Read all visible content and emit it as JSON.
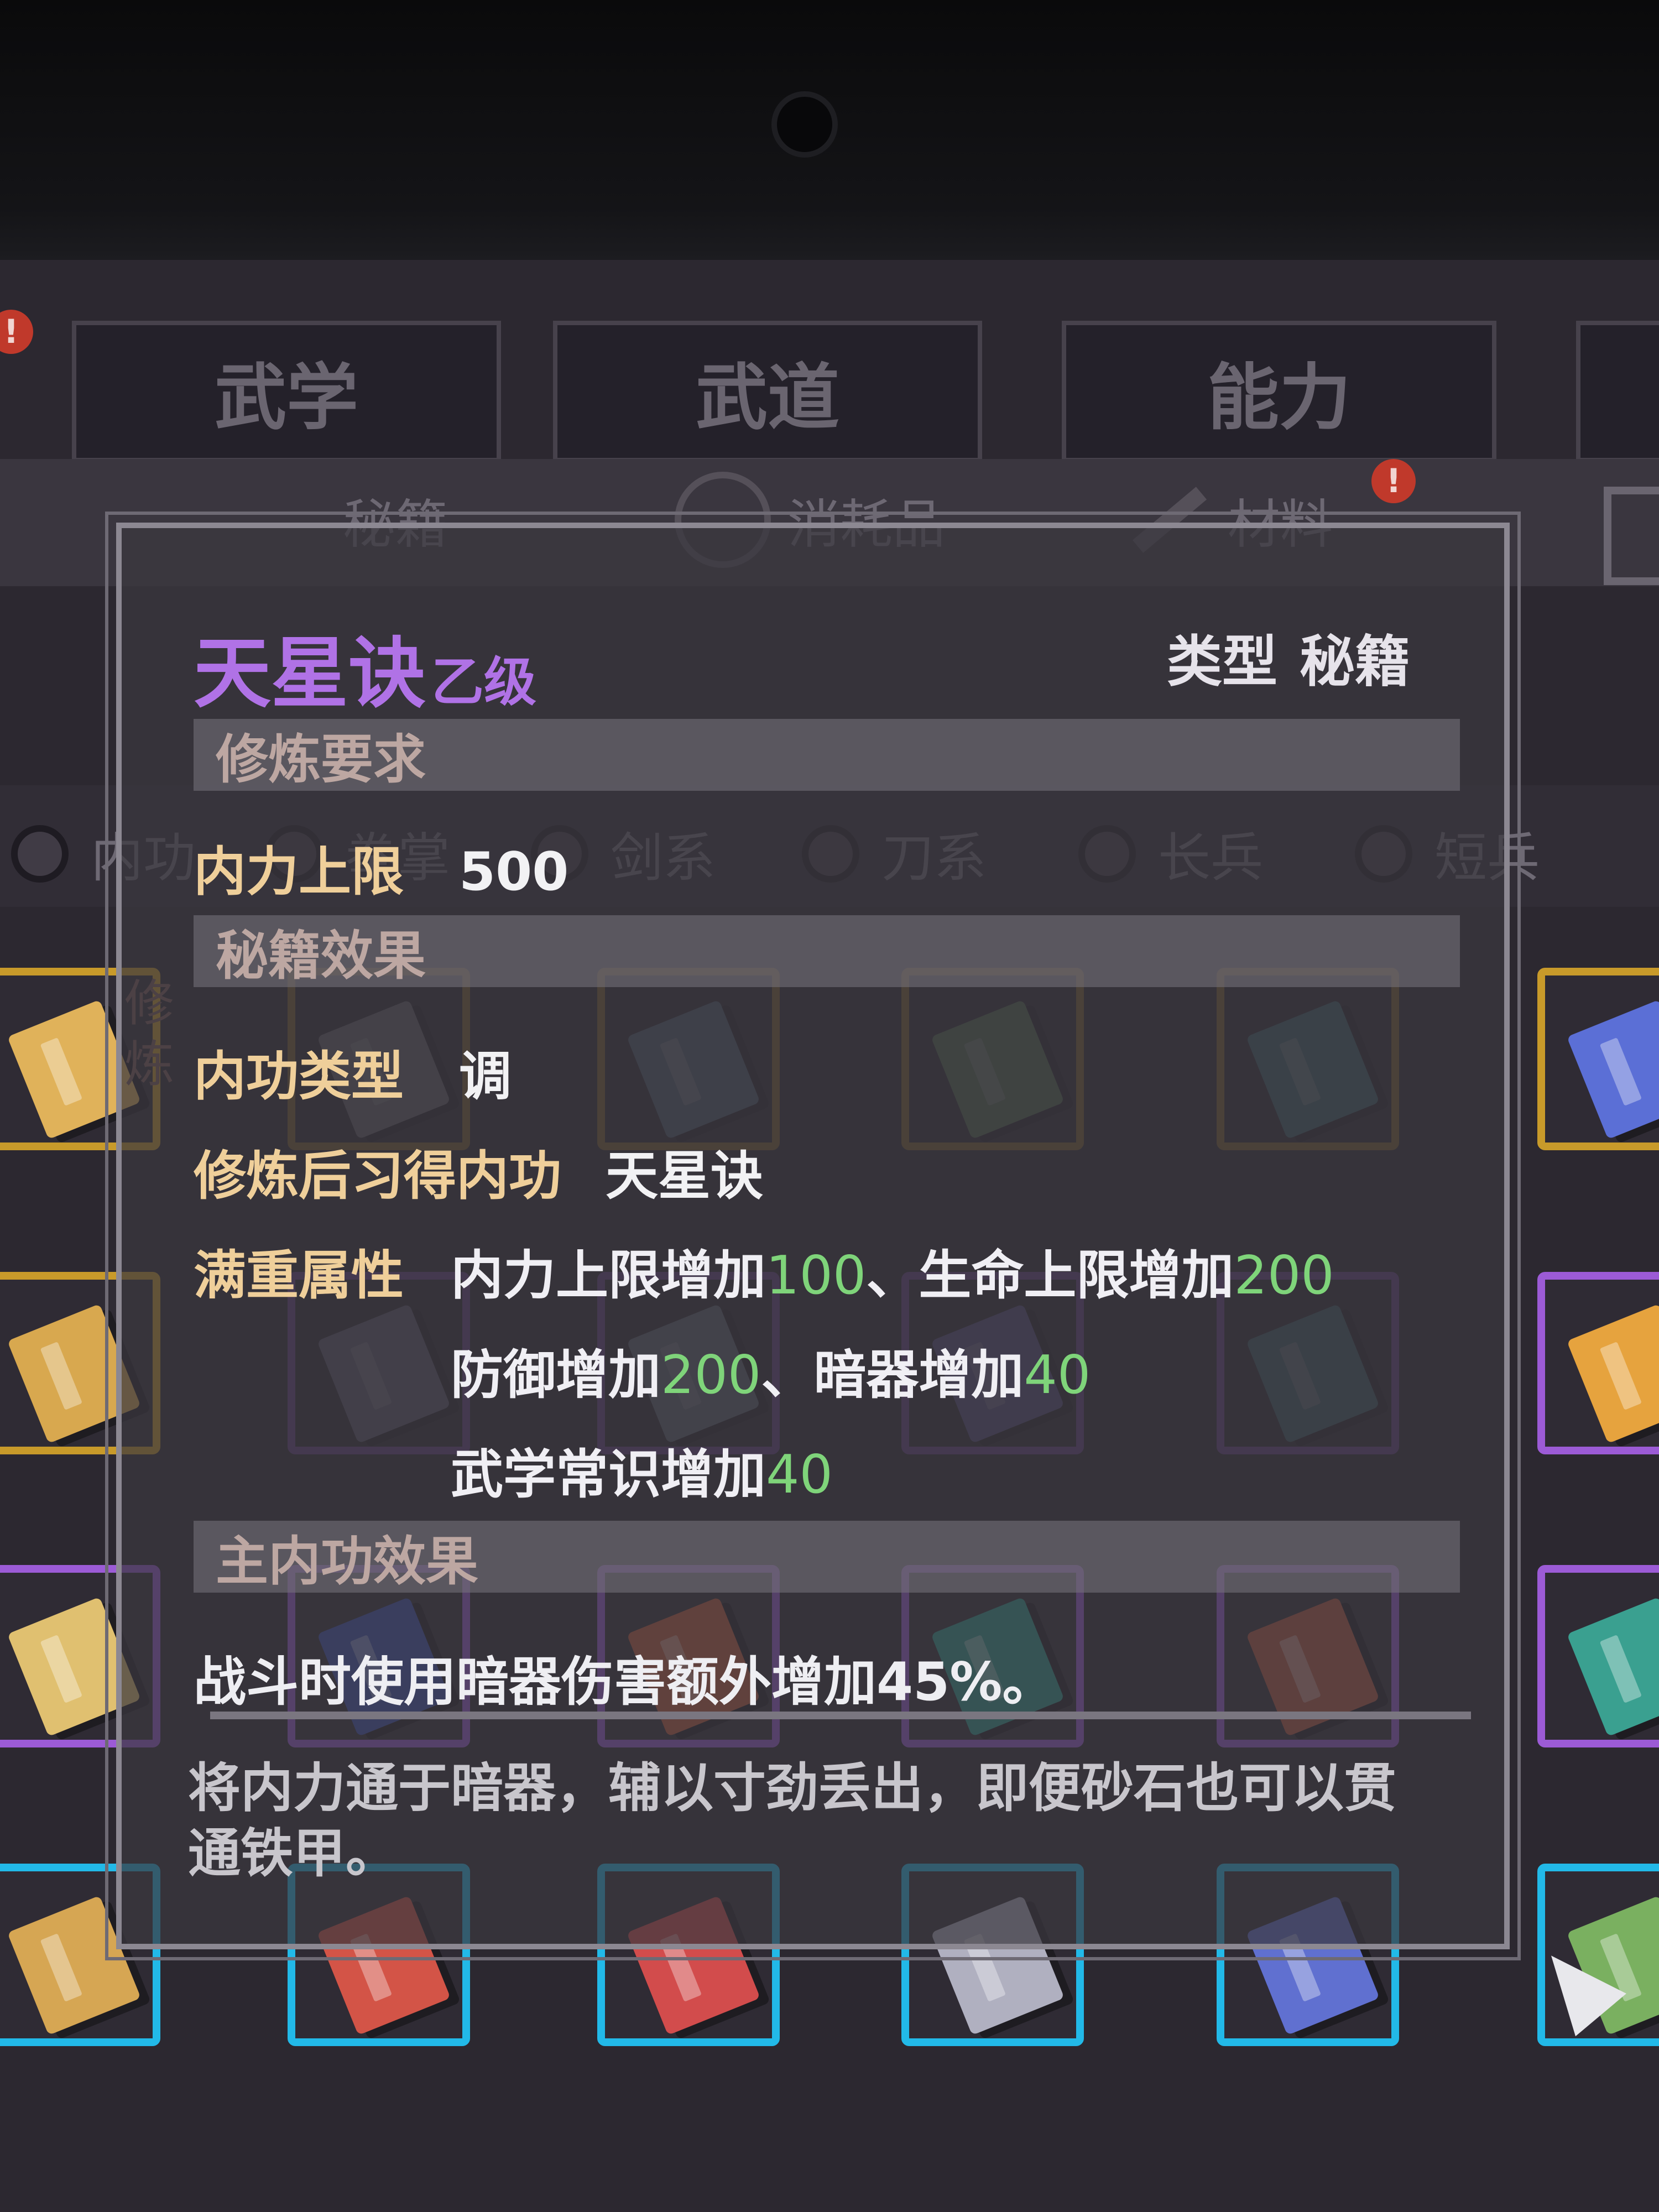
{
  "background": {
    "tabs": [
      "武学",
      "武道",
      "能力"
    ],
    "subcats": [
      "秘籍",
      "消耗品",
      "材料"
    ],
    "filters": [
      "内功",
      "拳掌",
      "剑系",
      "刀系",
      "长兵",
      "短兵"
    ],
    "side_tag": "修炼"
  },
  "tooltip": {
    "name": "天星诀",
    "grade": "乙级",
    "type_label": "类型",
    "type_value": "秘籍",
    "sections": {
      "requirements": "修炼要求",
      "effects": "秘籍效果",
      "main_effect": "主内功效果"
    },
    "requirement": {
      "label": "内力上限",
      "value": "500"
    },
    "neigong_type": {
      "label": "内功类型",
      "value": "调"
    },
    "learned": {
      "label": "修炼后习得内功",
      "value": "天星诀"
    },
    "full_attr_label": "满重属性",
    "attributes": [
      {
        "text": "内力上限增加",
        "value": "100",
        "sep": "、"
      },
      {
        "text": "生命上限增加",
        "value": "200",
        "sep": ""
      },
      {
        "text": "防御增加",
        "value": "200",
        "sep": "、"
      },
      {
        "text": "暗器增加",
        "value": "40",
        "sep": ""
      },
      {
        "text": "武学常识增加",
        "value": "40",
        "sep": ""
      }
    ],
    "main_effect_text": "战斗时使用暗器伤害额外增加45%。",
    "description": "将内力通于暗器，辅以寸劲丢出，即便砂石也可以贯通铁甲。"
  },
  "colors": {
    "title": "#b072e6",
    "label": "#efcf9a",
    "value_green": "#7fd47a",
    "type_cyan": "#48c9b0",
    "frame_gold": "#c89a2a",
    "frame_purple": "#9c5bd6",
    "frame_blue": "#22b9e8"
  }
}
